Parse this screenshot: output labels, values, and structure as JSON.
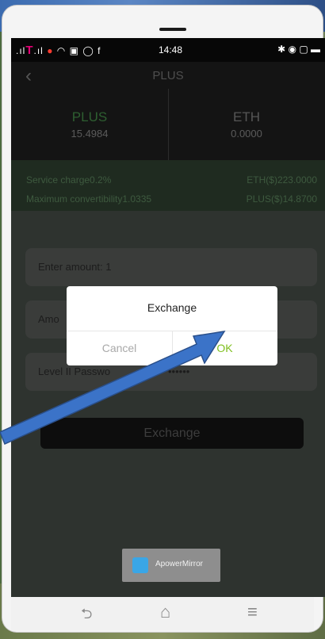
{
  "status_bar": {
    "carrier_text": "T",
    "time": "14:48",
    "left_icons": [
      "signal-icon",
      "recording-icon",
      "wifi-icon",
      "gallery-icon",
      "whatsapp-icon",
      "facebook-icon"
    ],
    "right_icons": [
      "bluetooth-icon",
      "eye-icon",
      "nfc-icon",
      "battery-icon"
    ]
  },
  "header": {
    "title": "PLUS"
  },
  "balances": {
    "left": {
      "name": "PLUS",
      "amount": "15.4984"
    },
    "right": {
      "name": "ETH",
      "amount": "0.0000"
    }
  },
  "info": {
    "service_charge": "Service charge0.2%",
    "eth_price": "ETH($)223.0000",
    "max_convertibility": "Maximum convertibility1.0335",
    "plus_price": "PLUS($)14.8700"
  },
  "form": {
    "amount_label": "Enter amount:  1",
    "received_label": "Amo",
    "password_label": "Level II Passwo",
    "password_mask": "••••••",
    "exchange_button": "Exchange"
  },
  "dialog": {
    "title": "Exchange",
    "cancel": "Cancel",
    "ok": "OK"
  },
  "watermark": {
    "text": "ApowerMirror"
  },
  "navbar": {
    "back": "⮌",
    "home": "⌂",
    "menu": "≡"
  },
  "colors": {
    "ok_green": "#7fbf1f",
    "arrow_blue": "#3b73c8",
    "plus_green": "#2e5f31"
  }
}
